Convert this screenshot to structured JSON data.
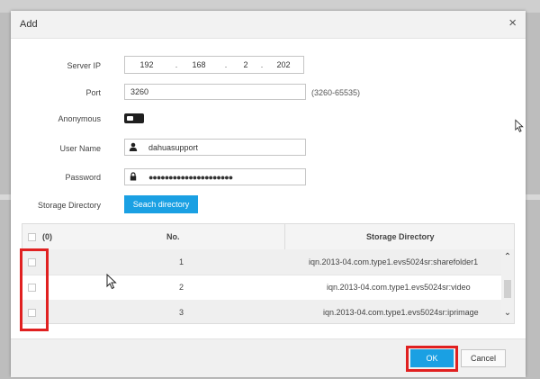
{
  "dialog": {
    "title": "Add",
    "close_glyph": "×"
  },
  "form": {
    "server_ip": {
      "label": "Server IP",
      "octets": [
        "192",
        "168",
        "2",
        "202"
      ],
      "separator": "."
    },
    "port": {
      "label": "Port",
      "value": "3260",
      "hint": "(3260-65535)"
    },
    "anonymous": {
      "label": "Anonymous",
      "enabled": false
    },
    "user_name": {
      "label": "User Name",
      "value": "dahuasupport",
      "icon": "user-icon"
    },
    "password": {
      "label": "Password",
      "value": "●●●●●●●●●●●●●●●●●●●●●",
      "icon": "lock-icon"
    },
    "storage_directory": {
      "label": "Storage Directory",
      "button": "Seach directory"
    }
  },
  "table": {
    "header": {
      "count": "(0)",
      "no": "No.",
      "storage_directory": "Storage Directory"
    },
    "rows": [
      {
        "no": "1",
        "dir": "iqn.2013-04.com.type1.evs5024sr:sharefolder1",
        "checked": false
      },
      {
        "no": "2",
        "dir": "iqn.2013-04.com.type1.evs5024sr:video",
        "checked": false
      },
      {
        "no": "3",
        "dir": "iqn.2013-04.com.type1.evs5024sr:iprimage",
        "checked": false
      }
    ],
    "scroll_up": "⌃",
    "scroll_down": "⌄"
  },
  "footer": {
    "ok": "OK",
    "cancel": "Cancel"
  },
  "colors": {
    "accent": "#1aa0e3",
    "highlight": "#e02020",
    "toggle": "#1f1f1f"
  }
}
